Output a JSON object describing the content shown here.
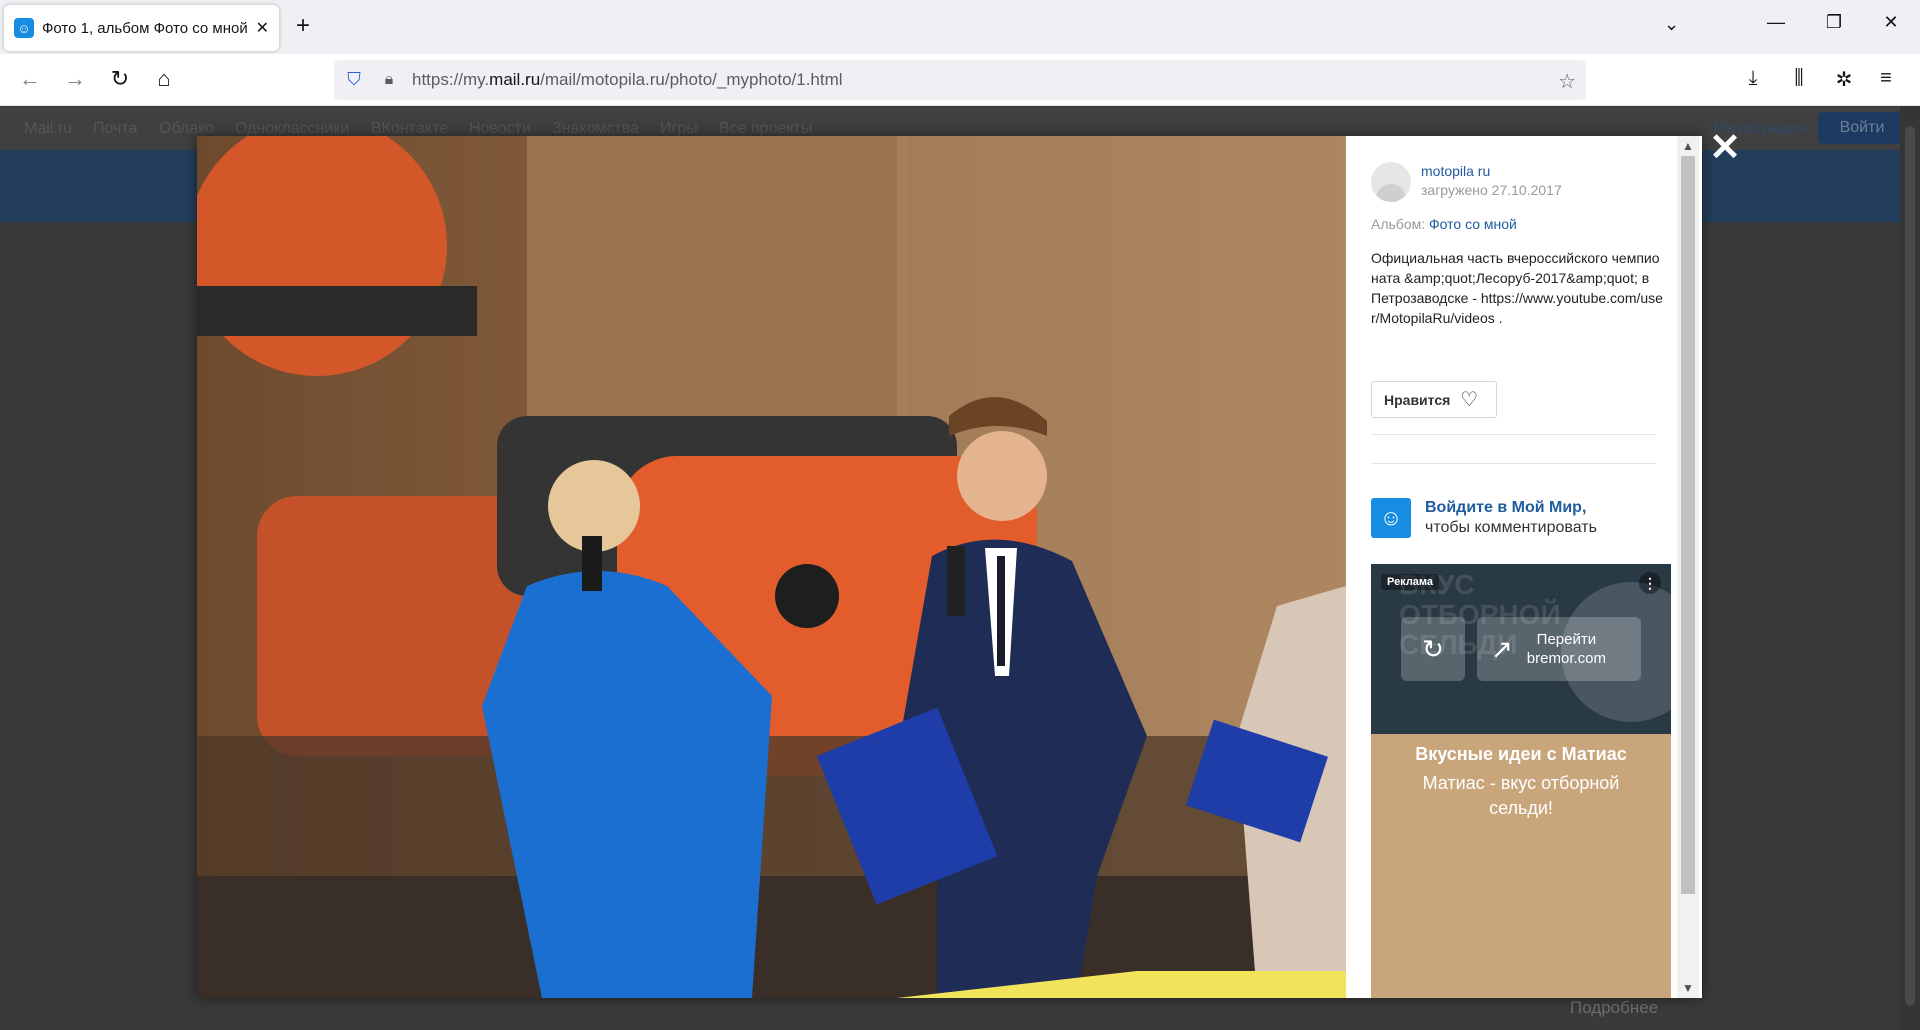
{
  "browser": {
    "tab_title": "Фото 1, альбом Фото со мной",
    "tab_close": "✕",
    "new_tab": "+",
    "url_prefix": "https://my.",
    "url_domain": "mail.ru",
    "url_suffix": "/mail/motopila.ru/photo/_myphoto/1.html"
  },
  "page_behind": {
    "portal_links": [
      "Mail.ru",
      "Почта",
      "Облако",
      "Одноклассники",
      "ВКонтакте",
      "Новости",
      "Знакомства",
      "Игры",
      "Все проекты"
    ],
    "register": "Регистрация",
    "login": "Войти",
    "more": "Подробнее"
  },
  "viewer": {
    "close": "✕",
    "author_name": "motopila ru",
    "uploaded": "загружено 27.10.2017",
    "album_label": "Альбом: ",
    "album_name": "Фото со мной",
    "description": "Официальная часть вчероссийского чемпионата &amp;quot;Лесоруб-2017&amp;quot; в Петрозаводске - https://www.youtube.com/user/MotopilaRu/videos .",
    "like_label": "Нравится",
    "login_link": "Войдите в Мой Мир,",
    "login_text": "чтобы комментировать",
    "ad": {
      "label": "Реклама",
      "bg_text_1": "ВКУС",
      "bg_text_2": "ОТБОРНОЙ",
      "bg_text_3": "СЕЛЬДИ",
      "go_line1": "Перейти",
      "go_line2": "bremor.com",
      "title": "Вкусные идеи с Матиас",
      "subtitle": "Матиас - вкус отборной сельди!"
    }
  },
  "colors": {
    "link": "#1f5c9e",
    "brand": "#168de2",
    "ad_bg": "#c9a57c"
  }
}
